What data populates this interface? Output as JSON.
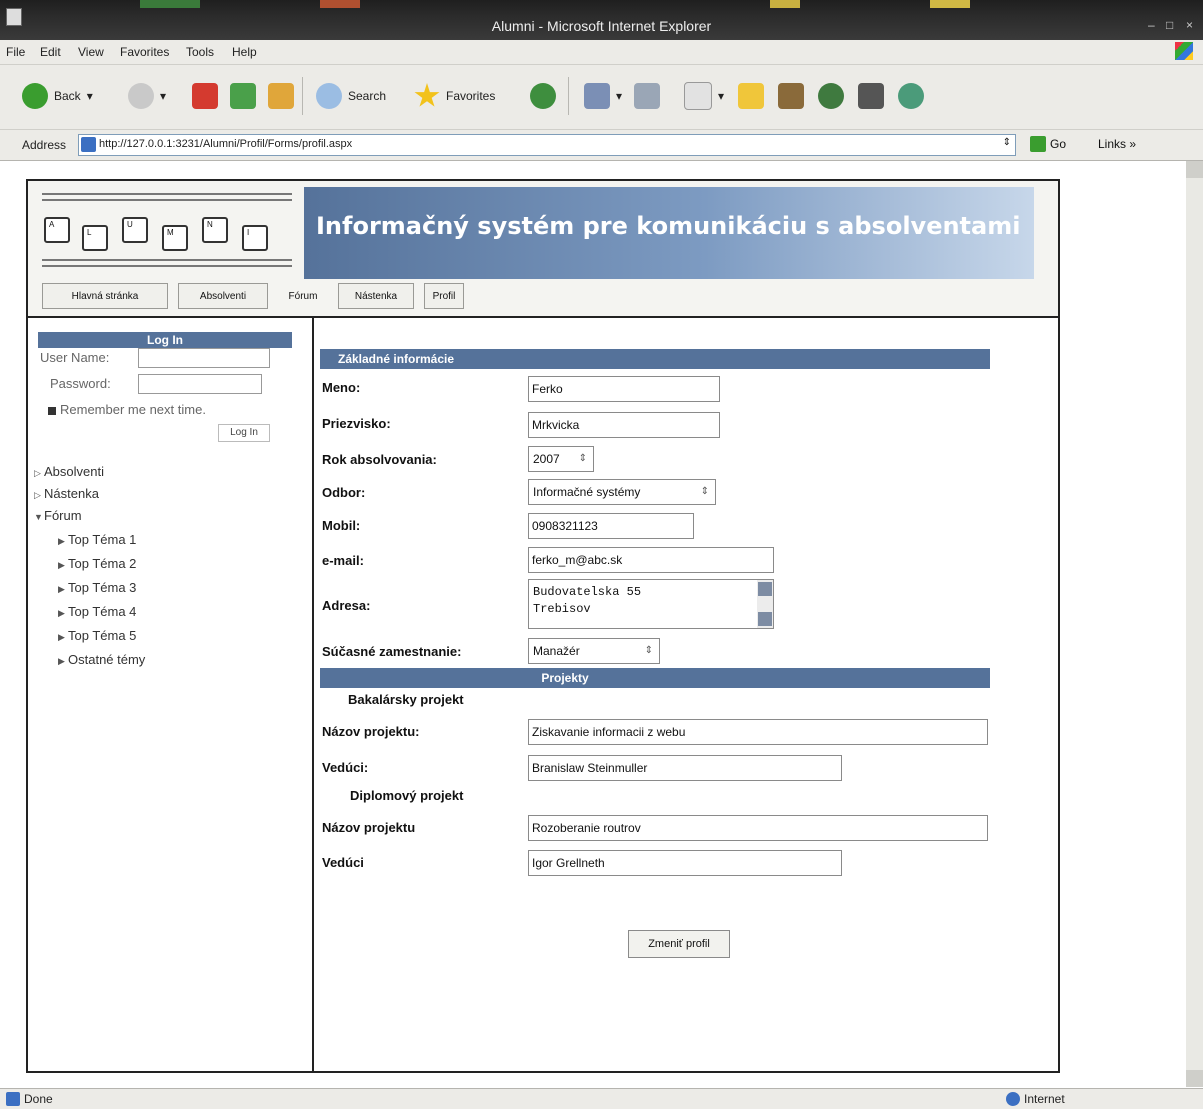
{
  "window": {
    "title": "Alumni - Microsoft Internet Explorer",
    "controls": [
      "–",
      "□",
      "×"
    ]
  },
  "menu": [
    "File",
    "Edit",
    "View",
    "Favorites",
    "Tools",
    "Help"
  ],
  "toolbar": {
    "back": "Back",
    "search": "Search",
    "favorites": "Favorites"
  },
  "address": {
    "label": "Address",
    "url": "http://127.0.0.1:3231/Alumni/Profil/Forms/profil.aspx",
    "go": "Go",
    "links": "Links"
  },
  "logo": {
    "keys": [
      "A",
      "L",
      "U",
      "M",
      "N",
      "I"
    ]
  },
  "header": {
    "title": "Informačný systém pre komunikáciu s absolventami"
  },
  "nav": [
    "Hlavná stránka",
    "Absolventi",
    "Fórum",
    "Nástenka",
    "Profil"
  ],
  "login": {
    "title": "Log In",
    "username_label": "User Name:",
    "password_label": "Password:",
    "remember": "Remember me next time.",
    "button": "Log In"
  },
  "tree": {
    "absolventi": "Absolventi",
    "nastenka": "Nástenka",
    "forum": "Fórum",
    "topics": [
      "Top Téma 1",
      "Top Téma 2",
      "Top Téma 3",
      "Top Téma 4",
      "Top Téma 5",
      "Ostatné témy"
    ]
  },
  "profile": {
    "section_basic": "Základné informácie",
    "meno_label": "Meno:",
    "meno": "Ferko",
    "priezvisko_label": "Priezvisko:",
    "priezvisko": "Mrkvicka",
    "rok_label": "Rok absolvovania:",
    "rok": "2007",
    "odbor_label": "Odbor:",
    "odbor": "Informačné systémy",
    "mobil_label": "Mobil:",
    "mobil": "0908321123",
    "email_label": "e-mail:",
    "email": "ferko_m@abc.sk",
    "adresa_label": "Adresa:",
    "adresa_line1": "Budovatelska 55",
    "adresa_line2": "Trebisov",
    "zamestnanie_label": "Súčasné zamestnanie:",
    "zamestnanie": "Manažér",
    "section_projects": "Projekty",
    "bakalarsky": "Bakalársky projekt",
    "nazov1_label": "Názov projektu:",
    "nazov1": "Ziskavanie informacii z webu",
    "veduci1_label": "Vedúci:",
    "veduci1": "Branislaw Steinmuller",
    "diplomovy": "Diplomový projekt",
    "nazov2_label": "Názov projektu",
    "nazov2": "Rozoberanie routrov",
    "veduci2_label": "Vedúci",
    "veduci2": "Igor Grellneth",
    "submit": "Zmeniť profil"
  },
  "status": {
    "left": "Done",
    "right": "Internet"
  }
}
